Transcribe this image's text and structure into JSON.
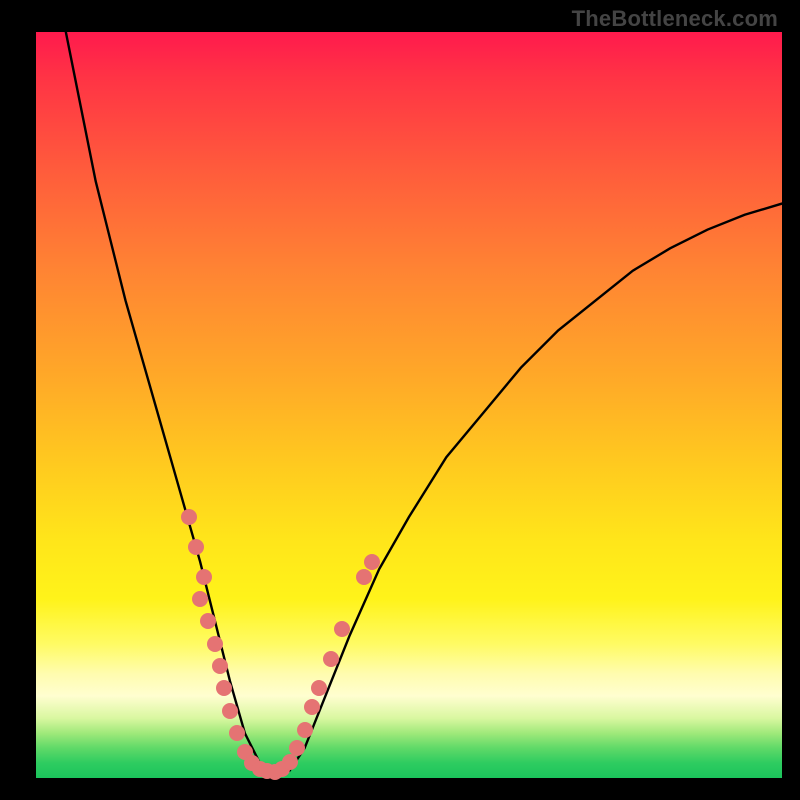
{
  "attribution": "TheBottleneck.com",
  "colors": {
    "dot": "#e57373",
    "curve": "#000000",
    "frame_bg": "#000000"
  },
  "chart_data": {
    "type": "line",
    "title": "",
    "xlabel": "",
    "ylabel": "",
    "xlim": [
      0,
      100
    ],
    "ylim": [
      0,
      100
    ],
    "grid": false,
    "series": [
      {
        "name": "bottleneck-curve",
        "x": [
          4,
          6,
          8,
          10,
          12,
          14,
          16,
          18,
          20,
          22,
          24,
          26,
          28,
          30,
          32,
          34,
          36,
          38,
          42,
          46,
          50,
          55,
          60,
          65,
          70,
          75,
          80,
          85,
          90,
          95,
          100
        ],
        "y": [
          100,
          90,
          80,
          72,
          64,
          57,
          50,
          43,
          36,
          29,
          21,
          13,
          6,
          2,
          0.5,
          1,
          4,
          9,
          19,
          28,
          35,
          43,
          49,
          55,
          60,
          64,
          68,
          71,
          73.5,
          75.5,
          77
        ]
      }
    ],
    "markers": [
      {
        "x": 20.5,
        "y": 35
      },
      {
        "x": 21.5,
        "y": 31
      },
      {
        "x": 22.5,
        "y": 27
      },
      {
        "x": 22.0,
        "y": 24
      },
      {
        "x": 23.0,
        "y": 21
      },
      {
        "x": 24.0,
        "y": 18
      },
      {
        "x": 24.6,
        "y": 15
      },
      {
        "x": 25.2,
        "y": 12
      },
      {
        "x": 26.0,
        "y": 9
      },
      {
        "x": 27.0,
        "y": 6
      },
      {
        "x": 28.0,
        "y": 3.5
      },
      {
        "x": 29.0,
        "y": 2.0
      },
      {
        "x": 30.0,
        "y": 1.2
      },
      {
        "x": 31.0,
        "y": 1.0
      },
      {
        "x": 32.0,
        "y": 0.8
      },
      {
        "x": 33.0,
        "y": 1.2
      },
      {
        "x": 34.0,
        "y": 2.2
      },
      {
        "x": 35.0,
        "y": 4
      },
      {
        "x": 36.0,
        "y": 6.5
      },
      {
        "x": 37.0,
        "y": 9.5
      },
      {
        "x": 38.0,
        "y": 12
      },
      {
        "x": 39.5,
        "y": 16
      },
      {
        "x": 41.0,
        "y": 20
      },
      {
        "x": 44.0,
        "y": 27
      },
      {
        "x": 45.0,
        "y": 29
      }
    ]
  }
}
